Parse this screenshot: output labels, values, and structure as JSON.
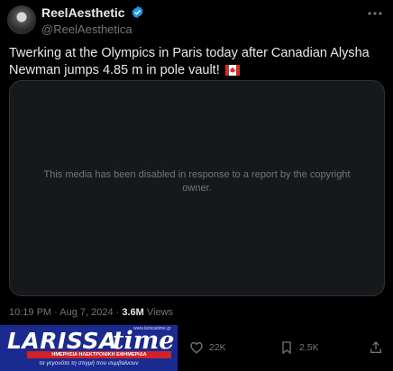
{
  "tweet": {
    "display_name": "ReelAesthetic",
    "handle": "@ReelAesthetica",
    "text": "Twerking at the Olympics in Paris today after Canadian Alysha Newman jumps 4.85 m in pole vault!",
    "flag": "canada-flag-emoji",
    "media_message": "This media has been disabled in response to a report by the copyright owner.",
    "time": "10:19 PM · Aug 7, 2024 · ",
    "views_count": "3.6M",
    "views_label": " Views"
  },
  "actions": {
    "likes": "22K",
    "bookmarks": "2.5K"
  },
  "watermark": {
    "brand_left": "LARISSA",
    "brand_right": "time",
    "url": "www.larissatime.gr",
    "red_band": "ΗΜΕΡΗΣΙΑ ΗΛΕΚΤΡΟΝΙΚΗ ΕΦΗΜΕΡΙΔΑ",
    "tagline": "τα γεγονότα τη στιγμή που συμβαίνουν"
  },
  "colors": {
    "background": "#000000",
    "text": "#e7e9ea",
    "muted": "#71767b",
    "verified": "#1d9bf0",
    "watermark_blue": "#1b2a8f",
    "watermark_red": "#d42027"
  }
}
